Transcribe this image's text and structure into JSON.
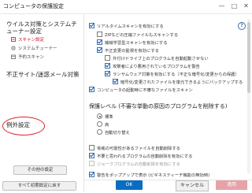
{
  "window": {
    "title": "コンピュータの保護設定",
    "minimize": "—",
    "maximize": "□",
    "close": "✕"
  },
  "sidebar": {
    "section1_title": "ウイルス対策とシステムチューナー設定",
    "items": [
      {
        "label": "スキャン設定",
        "active": true
      },
      {
        "label": "システムチューナー",
        "active": false
      },
      {
        "label": "予約スキャン",
        "active": false
      }
    ],
    "section2_title": "不正サイト/迷惑メール対策",
    "section3_title": "例外設定",
    "other_settings_button": "その他の設定",
    "reset_button": "すべて初期設定に戻す"
  },
  "main": {
    "realtime": {
      "label": "リアルタイムスキャンを有効にする",
      "checked": true,
      "options": [
        {
          "label": "ZIPなどの圧縮ファイルもスキャンする",
          "checked": false,
          "indent": 1,
          "enabled": true
        },
        {
          "label": "機械学習型スキャンを有効にする",
          "checked": true,
          "indent": 1,
          "enabled": true
        },
        {
          "label": "不正変更の監視を有効にする",
          "checked": true,
          "indent": 1,
          "enabled": true
        },
        {
          "label": "外付けドライブ上のプログラムを自動起動させない",
          "checked": false,
          "indent": 2,
          "enabled": true
        },
        {
          "label": "攻撃者により悪用されているプログラムを警告",
          "checked": true,
          "indent": 2,
          "enabled": true
        },
        {
          "label": "ランサムウェア対策を有効にする（不正な暗号化/変更からの保護）",
          "checked": true,
          "indent": 2,
          "enabled": true
        },
        {
          "label": "暗号化/変更されたファイルを復元できるようにバックアップする",
          "checked": true,
          "indent": 3,
          "enabled": true
        }
      ]
    },
    "startup_scan": {
      "label": "コンピュータの起動時に不審なファイルをスキャン",
      "checked": true
    },
    "protection_level": {
      "title": "保護レベル (不審な挙動の原因のプログラムを削除する)",
      "options": [
        {
          "label": "標準",
          "selected": true
        },
        {
          "label": "高",
          "selected": false
        },
        {
          "label": "自動切り替え",
          "selected": false
        }
      ]
    },
    "bottom_options": [
      {
        "label": "脅威の可能性があるファイルを自動削除する",
        "checked": false,
        "enabled": true
      },
      {
        "label": "不要と思われるプログラムの自動削除を有効にする",
        "checked": true,
        "enabled": true
      },
      {
        "label": "ジョークプログラムの自動削除を有効にする",
        "checked": false,
        "enabled": false
      },
      {
        "label": "警告をポップアップで表示 (ビギネスティーチ機能の無効時)",
        "checked": true,
        "enabled": true
      }
    ]
  },
  "footer": {
    "ok": "OK",
    "cancel": "キャンセル",
    "apply": "適用"
  },
  "colors": {
    "accent_blue": "#0a6dc2",
    "active_red": "#c8102e",
    "highlight_circle": "#e0212a",
    "apply_disabled": "#e7a2a8"
  }
}
